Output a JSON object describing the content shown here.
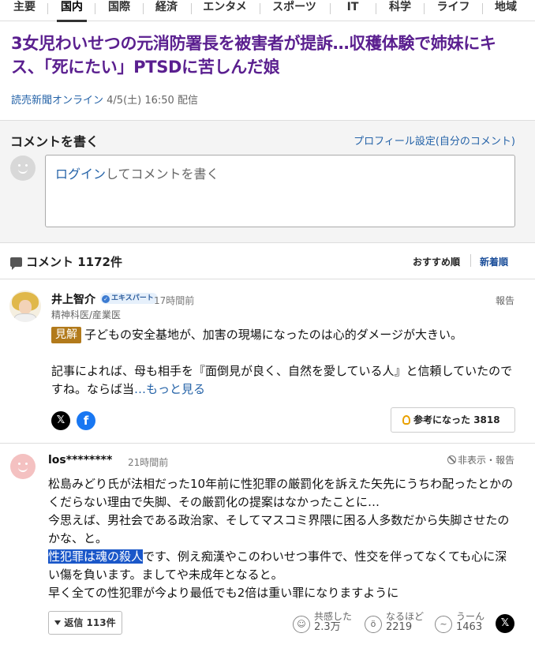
{
  "nav": {
    "items": [
      "主要",
      "国内",
      "国際",
      "経済",
      "エンタメ",
      "スポーツ",
      "IT",
      "科学",
      "ライフ",
      "地域"
    ],
    "active": "国内"
  },
  "article": {
    "title": "3女児わいせつの元消防署長を被害者が提訴…収穫体験で姉妹にキス、「死にたい」PTSDに苦しんだ娘",
    "source": "読売新聞オンライン",
    "date": "4/5(土) 16:50",
    "date_suffix": "配信"
  },
  "write": {
    "title": "コメントを書く",
    "profile_link": "プロフィール設定(自分のコメント)",
    "login": "ログイン",
    "placeholder_rest": "してコメントを書く"
  },
  "comments_header": {
    "label": "コメント 1172件",
    "sort_recommended": "おすすめ順",
    "sort_newest": "新着順"
  },
  "comment1": {
    "name": "井上智介",
    "badge": "エキスパート",
    "time": "17時間前",
    "role": "精神科医/産業医",
    "report": "報告",
    "tag": "見解",
    "text_line1": "子どもの安全基地が、加害の現場になったのは心的ダメージが大きい。",
    "text_para2": "記事によれば、母も相手を『面倒見が良く、自然を愛している人』と信頼していたのですね。ならば当",
    "more": "…もっと見る",
    "helpful_label": "参考になった",
    "helpful_count": "3818",
    "x_icon": "𝕏",
    "fb_icon": "f"
  },
  "comment2": {
    "name": "los********",
    "time": "21時間前",
    "hide_report": "非表示・報告",
    "line1": "松島みどり氏が法相だった10年前に性犯罪の厳罰化を訴えた矢先にうちわ配ったとかの",
    "line2": "くだらない理由で失脚、その厳罰化の提案はなかったことに…",
    "line3": "今思えば、男社会である政治家、そしてマスコミ界隈に困る人多数だから失脚させたの",
    "line4": "かな、と。",
    "highlight": "性犯罪は魂の殺人",
    "line5_rest": "です、例え痴漢やこのわいせつ事件で、性交を伴ってなくても心に深",
    "line6": "い傷を負います。ましてや未成年となると。",
    "line7": "早く全ての性犯罪が今より最低でも2倍は重い罪になりますように",
    "replies": "返信 113件",
    "react_agree_label": "共感した",
    "react_agree_count": "2.3万",
    "react_insight_label": "なるほど",
    "react_insight_count": "2219",
    "react_hmm_label": "うーん",
    "react_hmm_count": "1463",
    "x_icon": "𝕏"
  }
}
